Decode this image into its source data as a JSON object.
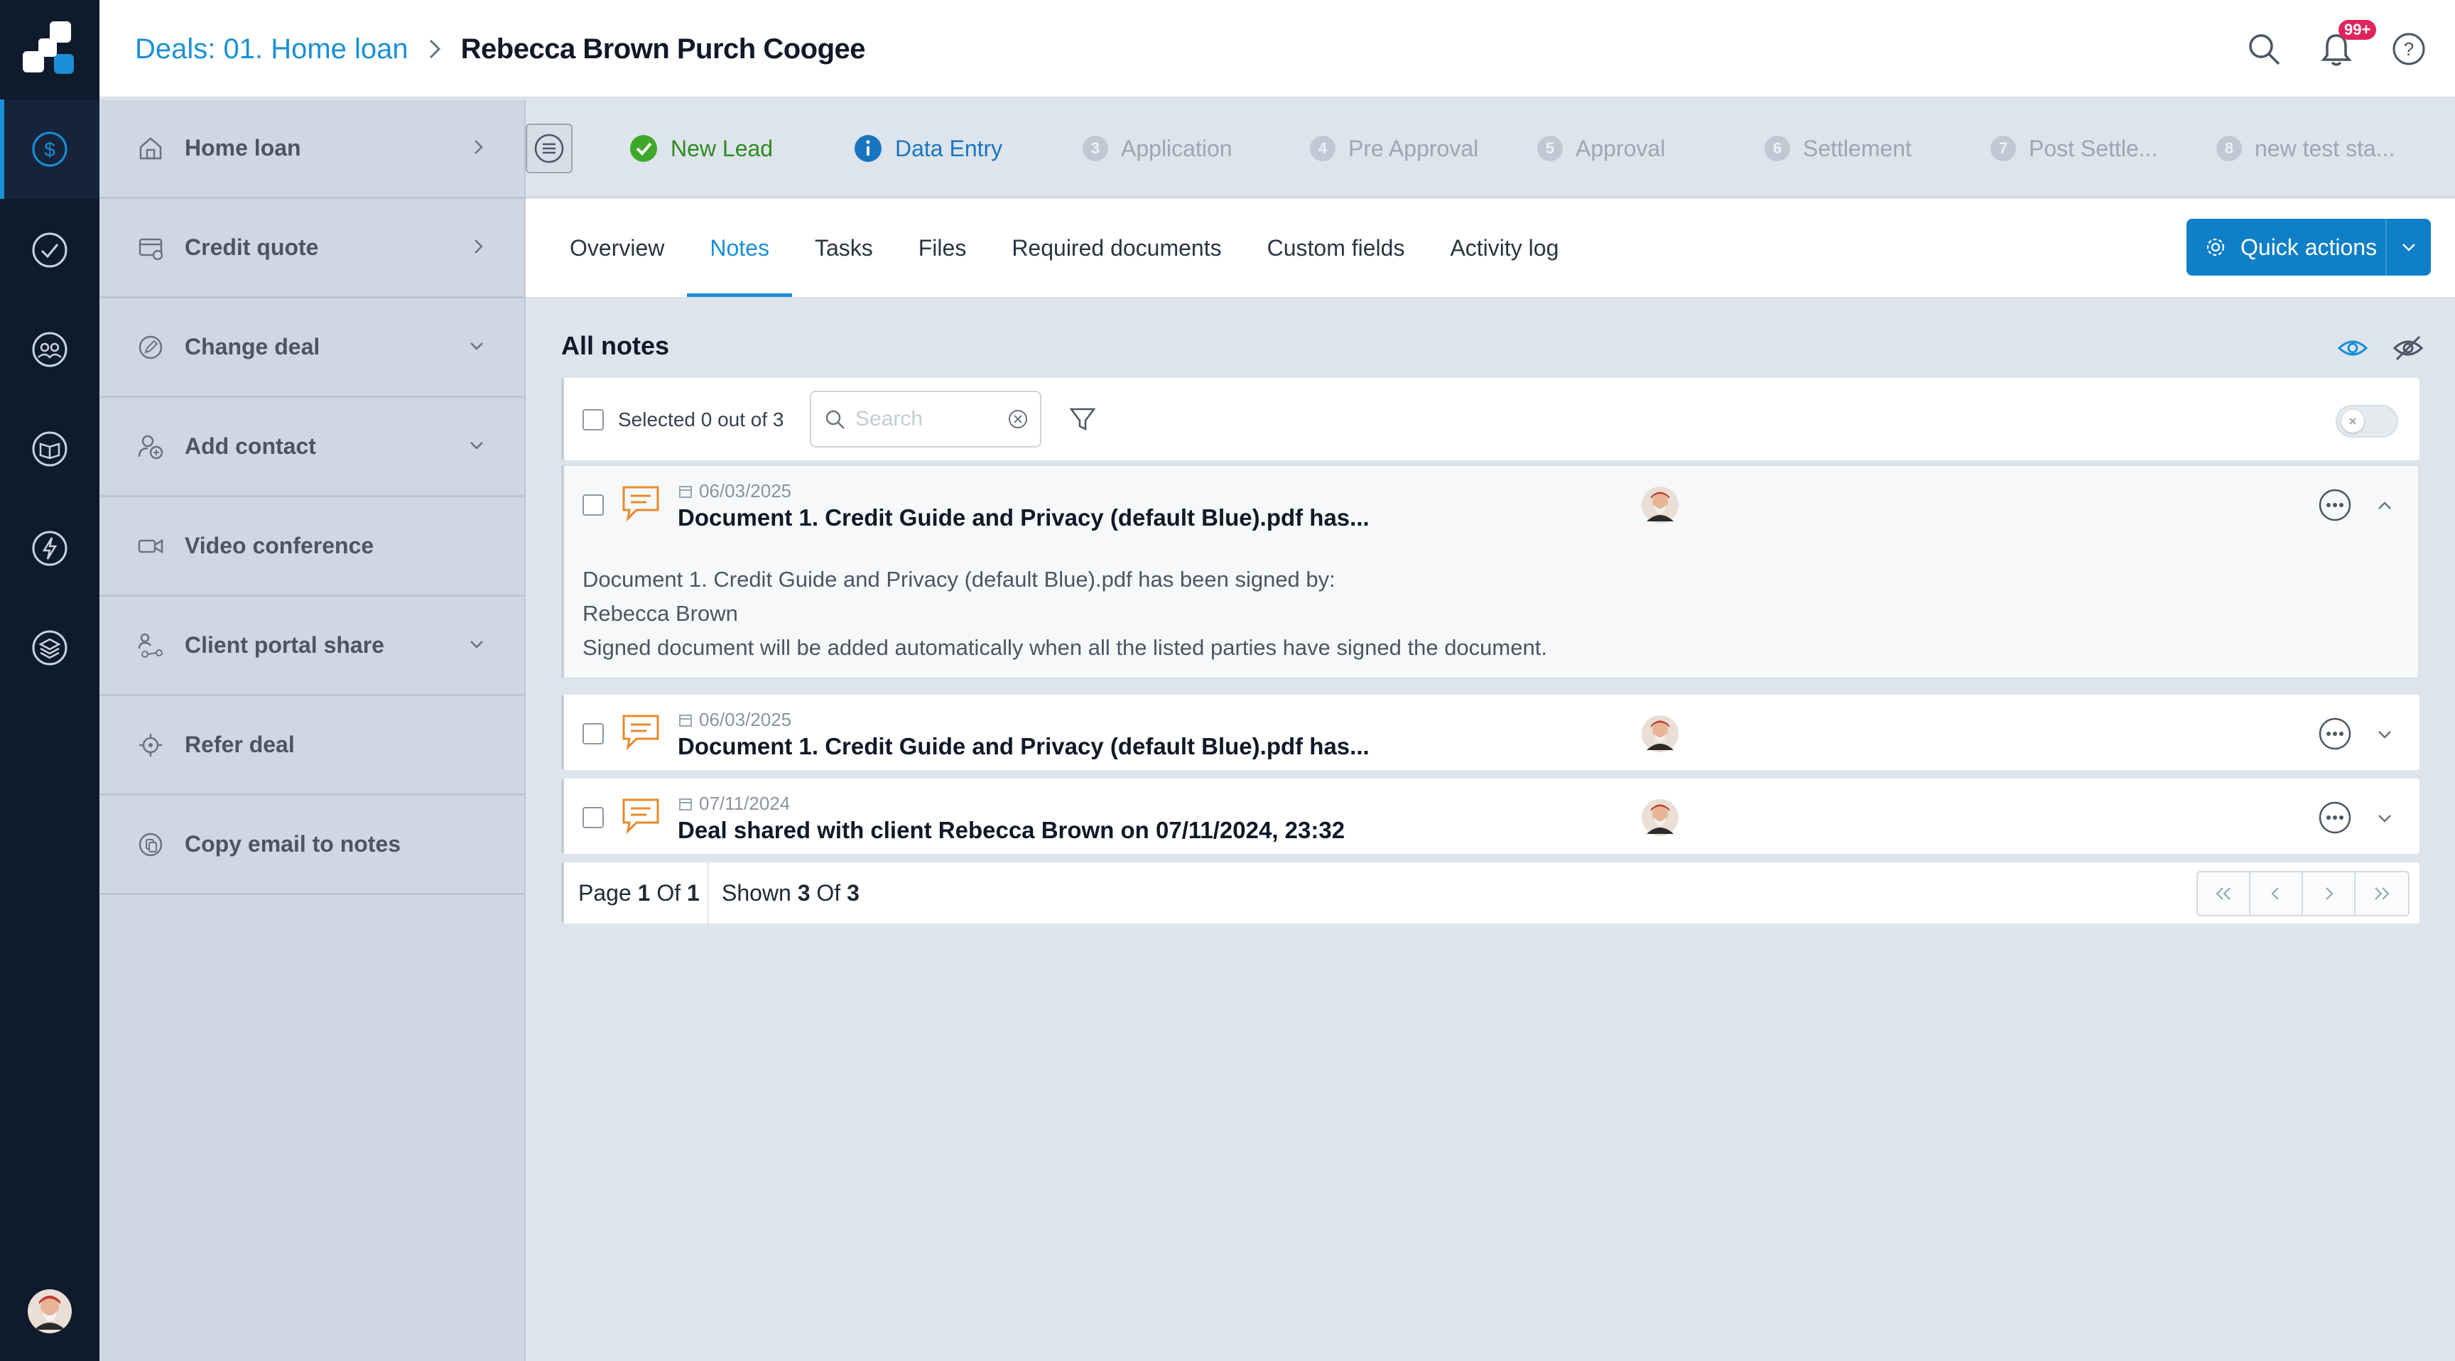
{
  "header": {
    "breadcrumb_link": "Deals: 01. Home loan",
    "breadcrumb_current": "Rebecca Brown Purch Coogee",
    "notification_badge": "99+"
  },
  "side_menu": {
    "items": [
      {
        "label": "Home loan",
        "icon": "home-loan-icon",
        "chevron": "right"
      },
      {
        "label": "Credit quote",
        "icon": "credit-quote-icon",
        "chevron": "right"
      },
      {
        "label": "Change deal",
        "icon": "change-deal-icon",
        "chevron": "down"
      },
      {
        "label": "Add contact",
        "icon": "add-contact-icon",
        "chevron": "down"
      },
      {
        "label": "Video conference",
        "icon": "video-icon",
        "chevron": ""
      },
      {
        "label": "Client portal share",
        "icon": "share-icon",
        "chevron": "down"
      },
      {
        "label": "Refer deal",
        "icon": "refer-icon",
        "chevron": ""
      },
      {
        "label": "Copy email to notes",
        "icon": "copy-email-icon",
        "chevron": ""
      }
    ]
  },
  "stages": [
    {
      "num": "",
      "label": "New Lead",
      "state": "done"
    },
    {
      "num": "",
      "label": "Data Entry",
      "state": "current"
    },
    {
      "num": "3",
      "label": "Application",
      "state": "pending"
    },
    {
      "num": "4",
      "label": "Pre Approval",
      "state": "pending"
    },
    {
      "num": "5",
      "label": "Approval",
      "state": "pending"
    },
    {
      "num": "6",
      "label": "Settlement",
      "state": "pending"
    },
    {
      "num": "7",
      "label": "Post Settle...",
      "state": "pending"
    },
    {
      "num": "8",
      "label": "new test sta...",
      "state": "pending"
    }
  ],
  "tabs": [
    "Overview",
    "Notes",
    "Tasks",
    "Files",
    "Required documents",
    "Custom fields",
    "Activity log"
  ],
  "active_tab": "Notes",
  "quick_actions_label": "Quick actions",
  "notes": {
    "heading": "All notes",
    "selected_text": "Selected 0 out of 3",
    "search_placeholder": "Search",
    "search_value": "",
    "items": [
      {
        "date": "06/03/2025",
        "title": "Document 1. Credit Guide and Privacy (default Blue).pdf has...",
        "expanded": true,
        "body": [
          "Document 1. Credit Guide and Privacy (default Blue).pdf has been signed by:",
          "Rebecca Brown",
          "Signed document will be added automatically when all the listed parties have signed the document."
        ]
      },
      {
        "date": "06/03/2025",
        "title": "Document 1. Credit Guide and Privacy (default Blue).pdf has...",
        "expanded": false,
        "body": []
      },
      {
        "date": "07/11/2024",
        "title": "Deal shared with client Rebecca Brown on 07/11/2024, 23:32",
        "expanded": false,
        "body": []
      }
    ]
  },
  "pager": {
    "page_word": "Page",
    "page": "1",
    "of_word": "Of",
    "page_total": "1",
    "shown_word": "Shown",
    "shown": "3",
    "shown_total": "3"
  },
  "colors": {
    "accent": "#1a8fd6",
    "rail": "#0f1a2c",
    "done_green": "#2f8a1f",
    "note_icon_orange": "#e58a2b"
  }
}
